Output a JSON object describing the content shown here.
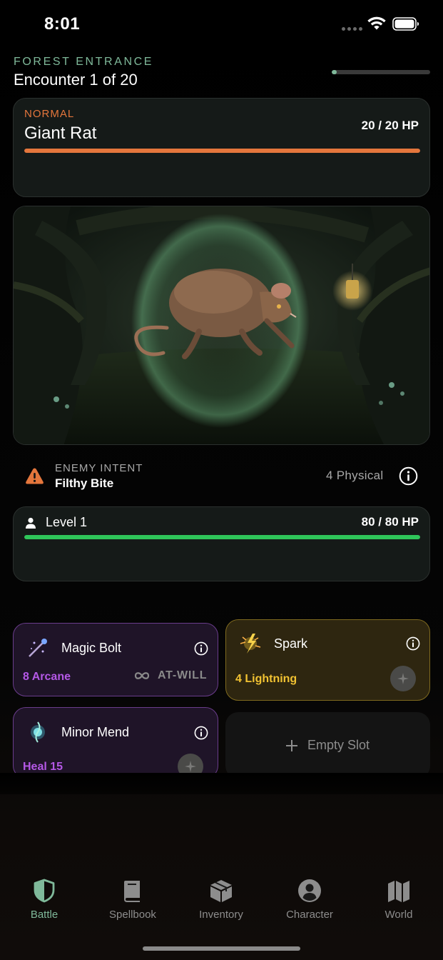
{
  "status_bar": {
    "time": "8:01",
    "icons": [
      "signal-dots-icon",
      "wifi-icon",
      "battery-icon"
    ]
  },
  "location": {
    "area": "FOREST ENTRANCE",
    "encounter": "Encounter 1 of 20",
    "progress": 0.05,
    "accent_color": "#7fb99a"
  },
  "enemy": {
    "tier": "NORMAL",
    "name": "Giant Rat",
    "hp_text": "20 / 20 HP",
    "hp_fraction": 1.0,
    "bar_color": "#e4763c"
  },
  "intent": {
    "label": "ENEMY INTENT",
    "name": "Filthy Bite",
    "damage": "4 Physical",
    "icon": "warning-icon"
  },
  "player": {
    "level": "Level 1",
    "hp_text": "80 / 80 HP",
    "hp_fraction": 1.0,
    "bar_color": "#2fc65a"
  },
  "spells": [
    {
      "name": "Magic Bolt",
      "stat": "8 Arcane",
      "tag": "AT-WILL",
      "icon": "magic-wand-icon",
      "color": "#b458e6"
    },
    {
      "name": "Spark",
      "stat": "4 Lightning",
      "icon": "lightning-spark-icon",
      "color": "#f1c232"
    },
    {
      "name": "Minor Mend",
      "stat": "Heal 15",
      "icon": "healing-orb-icon",
      "color": "#b458e6"
    }
  ],
  "empty_slot": {
    "label": "Empty Slot"
  },
  "tabs": [
    {
      "label": "Battle",
      "icon": "shield-icon",
      "active": true
    },
    {
      "label": "Spellbook",
      "icon": "book-icon",
      "active": false
    },
    {
      "label": "Inventory",
      "icon": "box-icon",
      "active": false
    },
    {
      "label": "Character",
      "icon": "person-circle-icon",
      "active": false
    },
    {
      "label": "World",
      "icon": "map-icon",
      "active": false
    }
  ]
}
